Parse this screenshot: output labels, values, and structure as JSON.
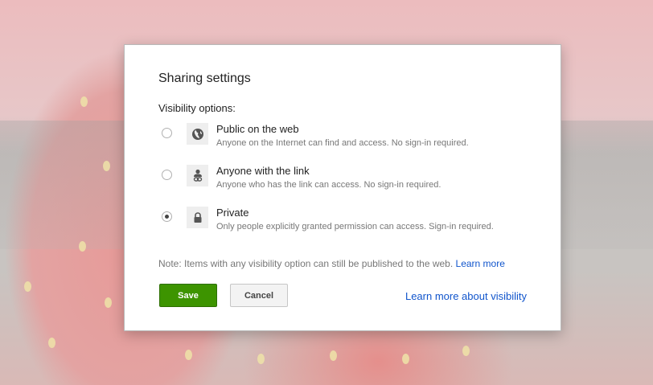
{
  "dialog": {
    "title": "Sharing settings",
    "visibility_label": "Visibility options:",
    "options": [
      {
        "title": "Public on the web",
        "description": "Anyone on the Internet can find and access. No sign-in required.",
        "icon": "globe-icon",
        "selected": false
      },
      {
        "title": "Anyone with the link",
        "description": "Anyone who has the link can access. No sign-in required.",
        "icon": "person-link-icon",
        "selected": false
      },
      {
        "title": "Private",
        "description": "Only people explicitly granted permission can access. Sign-in required.",
        "icon": "lock-icon",
        "selected": true
      }
    ],
    "note_text": "Note: Items with any visibility option can still be published to the web.",
    "note_link": "Learn more",
    "save_label": "Save",
    "cancel_label": "Cancel",
    "learn_more_visibility": "Learn more about visibility"
  },
  "colors": {
    "save_button": "#3d9400",
    "link": "#1155cc"
  }
}
